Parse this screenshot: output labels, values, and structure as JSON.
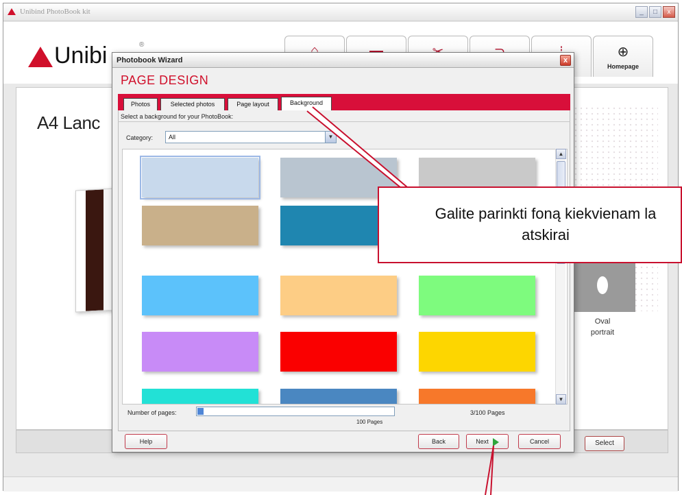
{
  "app": {
    "title": "Unibind PhotoBook kit",
    "brand": "Unibi",
    "brand_trademark": "®",
    "window_buttons": [
      "_",
      "□",
      "x"
    ]
  },
  "nav": {
    "tabs": [
      {
        "icon": "home-icon",
        "glyph": "⌂",
        "label": ""
      },
      {
        "icon": "folder-icon",
        "glyph": "▬",
        "label": ""
      },
      {
        "icon": "tools-icon",
        "glyph": "✂",
        "label": ""
      },
      {
        "icon": "shop-icon",
        "glyph": "⊃",
        "label": ""
      },
      {
        "icon": "upload-icon",
        "glyph": "⇣",
        "label": ""
      },
      {
        "icon": "globe-icon",
        "glyph": "⊕",
        "label": "Homepage"
      }
    ]
  },
  "background_page": {
    "format_title": "A4 Lanc",
    "oval_label_line1": "Oval",
    "oval_label_line2": "portrait",
    "select_label": "Select"
  },
  "wizard": {
    "title": "Photobook Wizard",
    "close_glyph": "x",
    "heading": "PAGE DESIGN",
    "tabs": [
      "Photos",
      "Selected photos",
      "Page layout",
      "Background"
    ],
    "active_tab": "Background",
    "instruction": "Select a background for your PhotoBook:",
    "category_label": "Category:",
    "category_value": "All",
    "swatches": [
      {
        "name": "sky-texture",
        "color": "#c8d9ec"
      },
      {
        "name": "water-texture",
        "color": "#b9c5d0"
      },
      {
        "name": "cracked-stone-texture",
        "color": "#c9c9c9"
      },
      {
        "name": "starfish-sand-photo",
        "color": "#c9b08a"
      },
      {
        "name": "pool-water-texture",
        "color": "#1f86b0"
      },
      {
        "name": "hidden-by-callout",
        "color": "#e0e0e0"
      },
      {
        "name": "light-blue",
        "color": "#5cc2fb"
      },
      {
        "name": "peach",
        "color": "#fdcd85"
      },
      {
        "name": "light-green",
        "color": "#7efb7e"
      },
      {
        "name": "lavender",
        "color": "#c88bf7"
      },
      {
        "name": "red",
        "color": "#fa0000"
      },
      {
        "name": "yellow",
        "color": "#fdd600"
      },
      {
        "name": "turquoise",
        "color": "#22e1d6"
      },
      {
        "name": "steel-blue",
        "color": "#4a87c1"
      },
      {
        "name": "orange",
        "color": "#f7782a"
      }
    ],
    "pages_label": "Number of pages:",
    "pages_current": 3,
    "pages_max_label": "100 Pages",
    "pages_count_label": "3/100 Pages",
    "buttons": {
      "help": "Help",
      "back": "Back",
      "next": "Next",
      "cancel": "Cancel"
    }
  },
  "callout": {
    "line1": "Galite parinkti foną kiekvienam la",
    "line2": "atskirai",
    "border_color": "#c8102e"
  },
  "colors": {
    "accent": "#d0102b",
    "tab_bar": "#d80f3a"
  }
}
